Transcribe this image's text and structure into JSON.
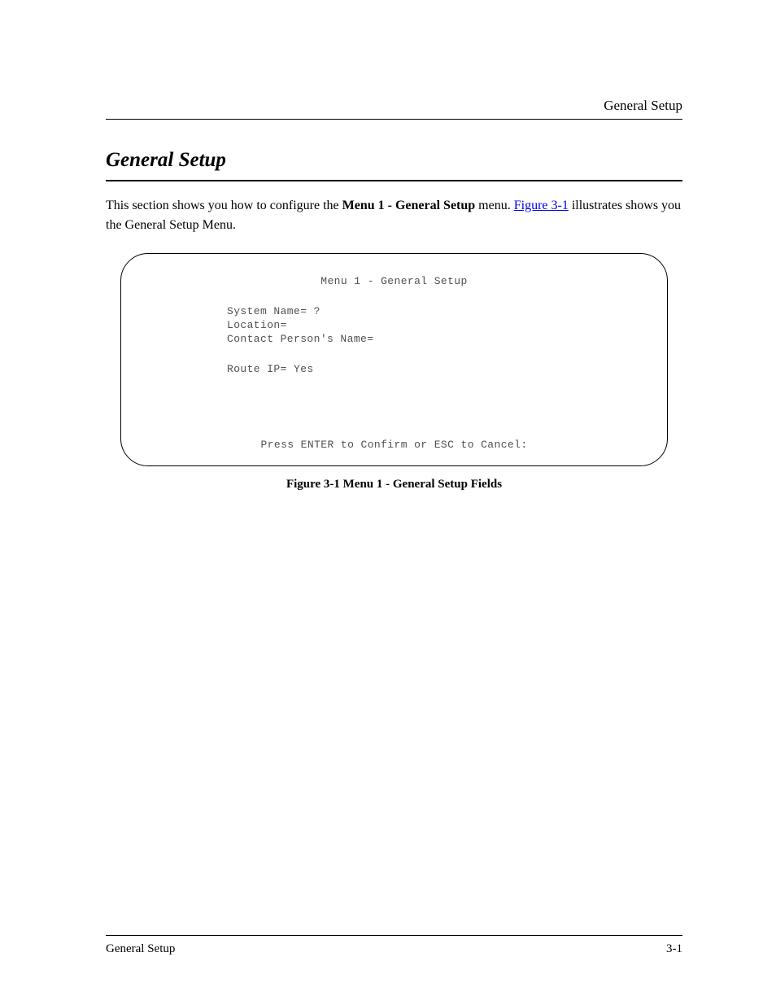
{
  "header": {
    "right": "General Setup"
  },
  "section": {
    "title": "General Setup",
    "intro_prefix": "This section shows you how to configure the ",
    "intro_strong": "Menu 1 - General Setup",
    "intro_mid": " menu. ",
    "link_text": "Figure 3-1",
    "intro_suffix": " illustrates shows you the General Setup Menu."
  },
  "terminal": {
    "title": "Menu 1 - General Setup",
    "fields": {
      "system_name": {
        "label": "System Name=",
        "value": " ?"
      },
      "location": {
        "label": "Location=",
        "value": ""
      },
      "contact": {
        "label": "Contact Person's Name=",
        "value": ""
      },
      "route_ip": {
        "label": "Route IP=",
        "value": " Yes"
      }
    },
    "footer": "Press ENTER to Confirm or ESC to Cancel:"
  },
  "caption": "Figure 3-1 Menu 1 - General Setup Fields",
  "footer": {
    "left": "General Setup",
    "right": "3-1"
  }
}
